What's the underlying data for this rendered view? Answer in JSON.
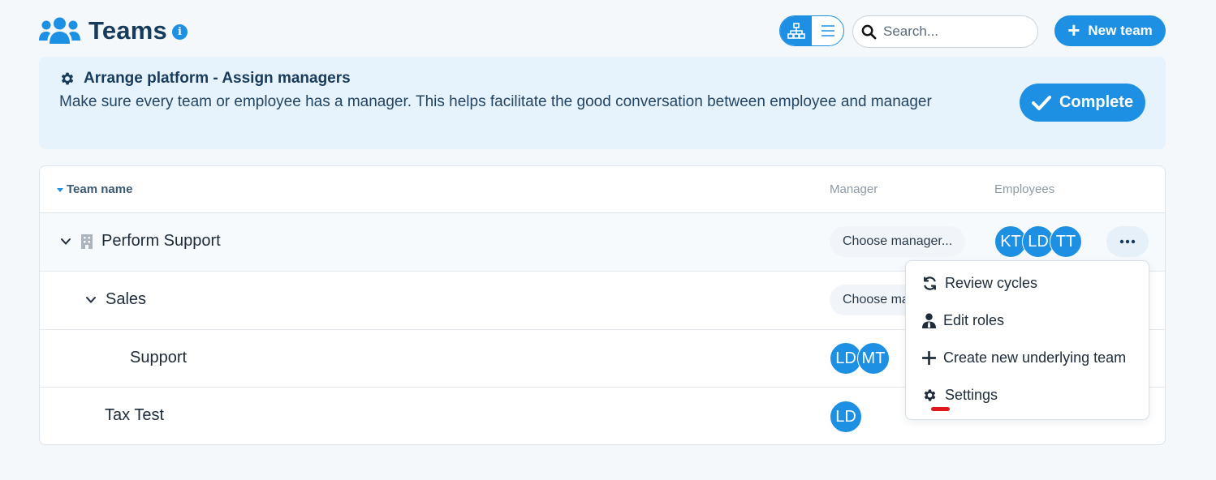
{
  "header": {
    "title": "Teams",
    "info_icon": "info-icon",
    "search_placeholder": "Search...",
    "new_team_label": "New team"
  },
  "banner": {
    "title": "Arrange platform - Assign managers",
    "text": "Make sure every team or employee has a manager. This helps facilitate the good conversation between employee and manager",
    "complete_label": "Complete"
  },
  "table": {
    "columns": {
      "team_name": "Team name",
      "manager": "Manager",
      "employees": "Employees"
    },
    "rows": [
      {
        "name": "Perform Support",
        "manager_placeholder": "Choose manager...",
        "employees": [
          "KT",
          "LD",
          "TT"
        ]
      },
      {
        "name": "Sales",
        "manager_placeholder": "Choose ma",
        "employees": []
      },
      {
        "name": "Support",
        "managers": [
          "LD",
          "MT"
        ]
      },
      {
        "name": "Tax Test",
        "managers": [
          "LD"
        ]
      }
    ]
  },
  "menu": {
    "items": [
      {
        "label": "Review cycles",
        "icon": "refresh-icon"
      },
      {
        "label": "Edit roles",
        "icon": "user-tie-icon"
      },
      {
        "label": "Create new underlying team",
        "icon": "plus-icon"
      },
      {
        "label": "Settings",
        "icon": "gear-icon"
      }
    ]
  },
  "colors": {
    "primary": "#1e90e3",
    "title": "#173b5c",
    "banner_bg": "#e6f3fc",
    "annotation": "#e0161e"
  }
}
